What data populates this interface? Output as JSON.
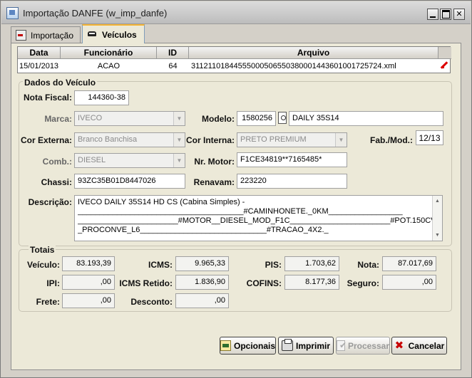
{
  "window": {
    "title": "Importação DANFE (w_imp_danfe)"
  },
  "tabs": [
    {
      "label": "Importação",
      "icon": "import-icon"
    },
    {
      "label": "Veículos",
      "icon": "vehicle-icon"
    }
  ],
  "grid": {
    "columns": [
      "Data",
      "Funcionário",
      "ID",
      "Arquivo"
    ],
    "row": {
      "data": "15/01/2013",
      "funcionario": "ACAO",
      "id": "64",
      "arquivo": "31121101844555000506550380001443601001725724.xml"
    }
  },
  "dados": {
    "title": "Dados do Veículo",
    "nota_fiscal": {
      "label": "Nota Fiscal:",
      "value": "144360-38"
    },
    "marca": {
      "label": "Marca:",
      "value": "IVECO"
    },
    "modelo": {
      "label": "Modelo:",
      "code": "1580256",
      "desc": "DAILY 35S14"
    },
    "cor_externa": {
      "label": "Cor Externa:",
      "value": "Branco Banchisa"
    },
    "cor_interna": {
      "label": "Cor Interna:",
      "value": "PRETO PREMIUM"
    },
    "fab_mod": {
      "label": "Fab./Mod.:",
      "value": "12/13"
    },
    "comb": {
      "label": "Comb.:",
      "value": "DIESEL"
    },
    "nr_motor": {
      "label": "Nr. Motor:",
      "value": "F1CE34819**7165485*"
    },
    "chassi": {
      "label": "Chassi:",
      "value": "93ZC35B01D8447026"
    },
    "renavam": {
      "label": "Renavam:",
      "value": "223220"
    },
    "descricao": {
      "label": "Descrição:",
      "lines": [
        "IVECO DAILY 35S14 HD CS (Cabina Simples) -",
        "______________________________________#CAMINHONETE._0KM_________________",
        "_______________________#MOTOR__DIESEL_MOD_F1C_______________________#POT.150CV_.",
        "_PROCONVE_L6_____________________________#TRACAO_4X2._"
      ]
    }
  },
  "totais": {
    "title": "Totais",
    "veiculo": {
      "label": "Veículo:",
      "value": "83.193,39"
    },
    "icms": {
      "label": "ICMS:",
      "value": "9.965,33"
    },
    "pis": {
      "label": "PIS:",
      "value": "1.703,62"
    },
    "nota": {
      "label": "Nota:",
      "value": "87.017,69"
    },
    "ipi": {
      "label": "IPI:",
      "value": ",00"
    },
    "icms_retido": {
      "label": "ICMS Retido:",
      "value": "1.836,90"
    },
    "cofins": {
      "label": "COFINS:",
      "value": "8.177,36"
    },
    "seguro": {
      "label": "Seguro:",
      "value": ",00"
    },
    "frete": {
      "label": "Frete:",
      "value": ",00"
    },
    "desconto": {
      "label": "Desconto:",
      "value": ",00"
    }
  },
  "buttons": {
    "opcionais": "Opcionais",
    "imprimir": "Imprimir",
    "processar": "Processar",
    "cancelar": "Cancelar"
  }
}
